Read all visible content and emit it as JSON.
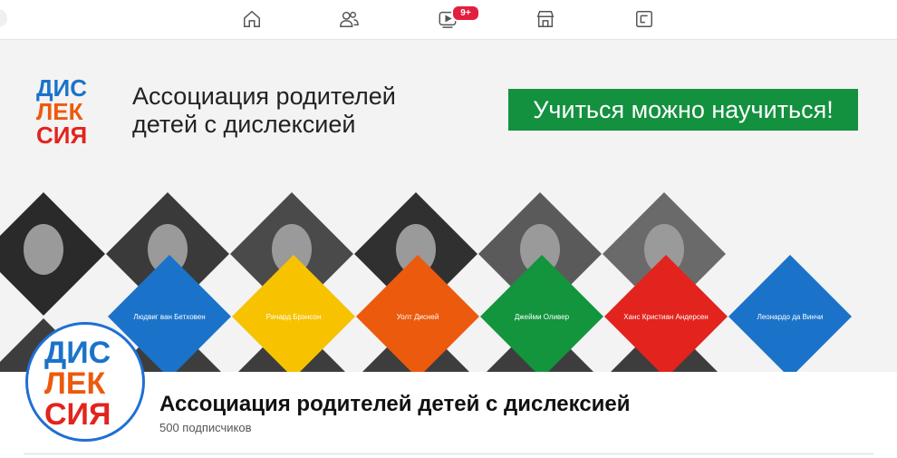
{
  "nav": {
    "items": [
      {
        "icon": "home-icon"
      },
      {
        "icon": "friends-icon"
      },
      {
        "icon": "video-icon",
        "badge": "9+"
      },
      {
        "icon": "marketplace-icon"
      },
      {
        "icon": "gaming-icon"
      }
    ]
  },
  "cover": {
    "logo_letters": [
      "ДИС",
      "ЛЕК",
      "СИЯ"
    ],
    "title_line1": "Ассоциация родителей",
    "title_line2": "детей с дислексией",
    "slogan": "Учиться можно научиться!",
    "people": [
      {
        "name": "Людвиг ван Бетховен",
        "color": "#1b73c9"
      },
      {
        "name": "Ричард Брэнсон",
        "color": "#f7c200"
      },
      {
        "name": "Уолт Дисней",
        "color": "#ec5a0d"
      },
      {
        "name": "Джейми Оливер",
        "color": "#12953d"
      },
      {
        "name": "Ханс Кристиан Андерсен",
        "color": "#e3231d"
      },
      {
        "name": "Леонардо да Винчи",
        "color": "#1b73c9"
      }
    ]
  },
  "profile": {
    "name": "Ассоциация родителей детей с дислексией",
    "followers": "500 подписчиков"
  },
  "colors": {
    "slogan_bg": "#13913f",
    "avatar_border": "#1f6fd4",
    "badge": "#e41e3f"
  }
}
